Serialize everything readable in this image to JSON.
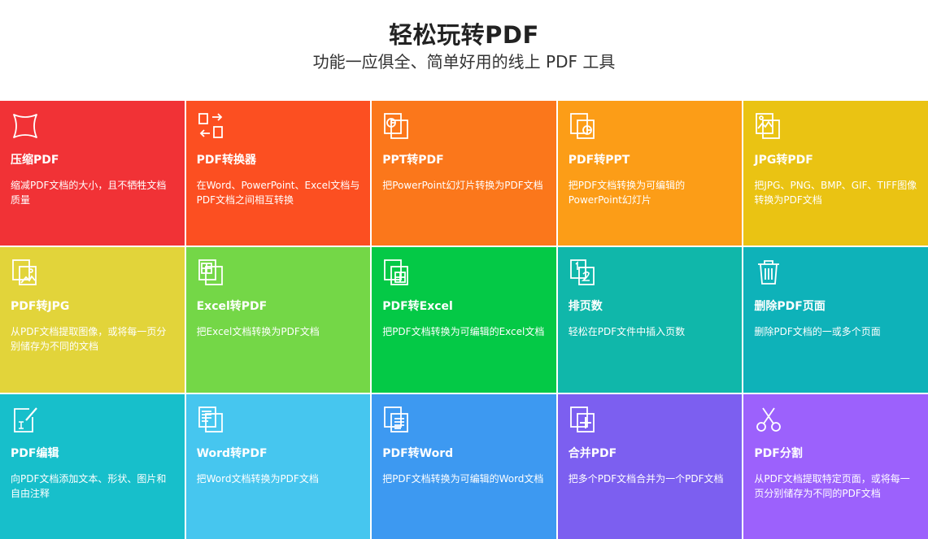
{
  "header": {
    "title": "轻松玩转PDF",
    "subtitle": "功能一应俱全、简单好用的线上 PDF 工具"
  },
  "tools": [
    {
      "name": "压缩PDF",
      "desc": "缩减PDF文档的大小，且不牺牲文档质量",
      "color": "#f13236",
      "icon": "compress-icon"
    },
    {
      "name": "PDF转换器",
      "desc": "在Word、PowerPoint、Excel文档与PDF文档之间相互转换",
      "color": "#fc4f21",
      "icon": "convert-icon"
    },
    {
      "name": "PPT转PDF",
      "desc": "把PowerPoint幻灯片转换为PDF文档",
      "color": "#fb771b",
      "icon": "ppt-to-pdf-icon"
    },
    {
      "name": "PDF转PPT",
      "desc": "把PDF文档转换为可编辑的PowerPoint幻灯片",
      "color": "#fc9d17",
      "icon": "pdf-to-ppt-icon"
    },
    {
      "name": "JPG转PDF",
      "desc": "把JPG、PNG、BMP、GIF、TIFF图像转换为PDF文档",
      "color": "#eac313",
      "icon": "jpg-to-pdf-icon"
    },
    {
      "name": "PDF转JPG",
      "desc": "从PDF文档提取图像，或将每一页分别储存为不同的文档",
      "color": "#e2d43a",
      "icon": "pdf-to-jpg-icon"
    },
    {
      "name": "Excel转PDF",
      "desc": "把Excel文档转换为PDF文档",
      "color": "#74d747",
      "icon": "excel-to-pdf-icon"
    },
    {
      "name": "PDF转Excel",
      "desc": "把PDF文档转换为可编辑的Excel文档",
      "color": "#04c946",
      "icon": "pdf-to-excel-icon"
    },
    {
      "name": "排页数",
      "desc": "轻松在PDF文件中插入页数",
      "color": "#10b7aa",
      "icon": "page-number-icon"
    },
    {
      "name": "删除PDF页面",
      "desc": "删除PDF文档的一或多个页面",
      "color": "#0eb2b9",
      "icon": "trash-icon"
    },
    {
      "name": "PDF编辑",
      "desc": "向PDF文档添加文本、形状、图片和自由注释",
      "color": "#17bfcb",
      "icon": "edit-icon"
    },
    {
      "name": "Word转PDF",
      "desc": "把Word文档转换为PDF文档",
      "color": "#46c6ef",
      "icon": "word-to-pdf-icon"
    },
    {
      "name": "PDF转Word",
      "desc": "把PDF文档转换为可编辑的Word文档",
      "color": "#3d99f1",
      "icon": "pdf-to-word-icon"
    },
    {
      "name": "合并PDF",
      "desc": "把多个PDF文档合并为一个PDF文档",
      "color": "#7c5ff0",
      "icon": "merge-icon"
    },
    {
      "name": "PDF分割",
      "desc": "从PDF文档提取特定页面，或将每一页分别储存为不同的PDF文档",
      "color": "#9c61fc",
      "icon": "scissors-icon"
    }
  ]
}
